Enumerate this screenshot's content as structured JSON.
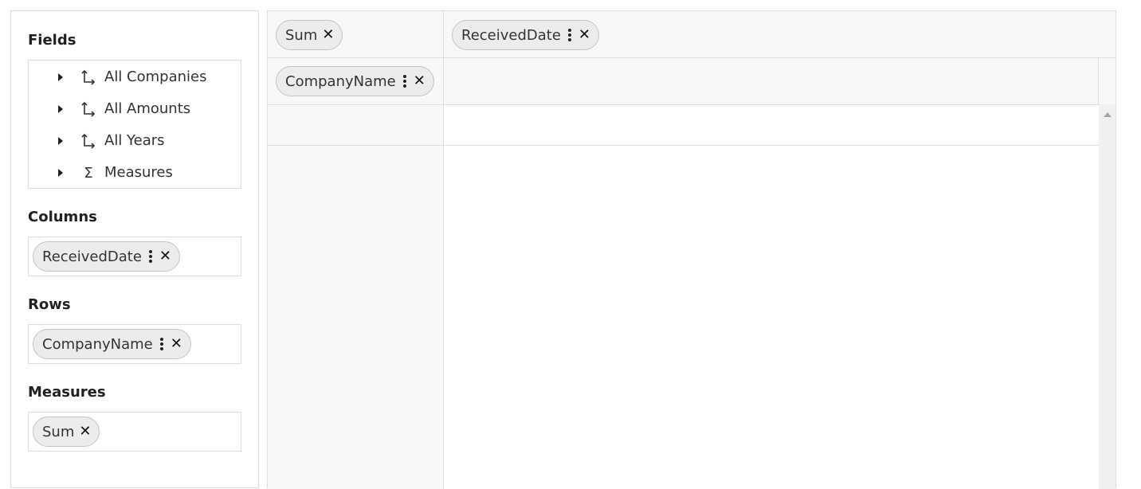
{
  "sidebar": {
    "fields_title": "Fields",
    "fields": [
      {
        "label": "All Companies",
        "icon": "hierarchy-icon"
      },
      {
        "label": "All Amounts",
        "icon": "hierarchy-icon"
      },
      {
        "label": "All Years",
        "icon": "hierarchy-icon"
      },
      {
        "label": "Measures",
        "icon": "sigma-icon"
      }
    ],
    "columns_title": "Columns",
    "columns_chip": "ReceivedDate",
    "rows_title": "Rows",
    "rows_chip": "CompanyName",
    "measures_title": "Measures",
    "measures_chip": "Sum"
  },
  "grid": {
    "measure_chip": "Sum",
    "column_chip": "ReceivedDate",
    "row_chip": "CompanyName"
  },
  "colors": {
    "border": "#dedede",
    "header_bg": "#f7f8f9",
    "chip_bg": "#ececec",
    "scrollbar_bg": "#f0f0f0"
  }
}
